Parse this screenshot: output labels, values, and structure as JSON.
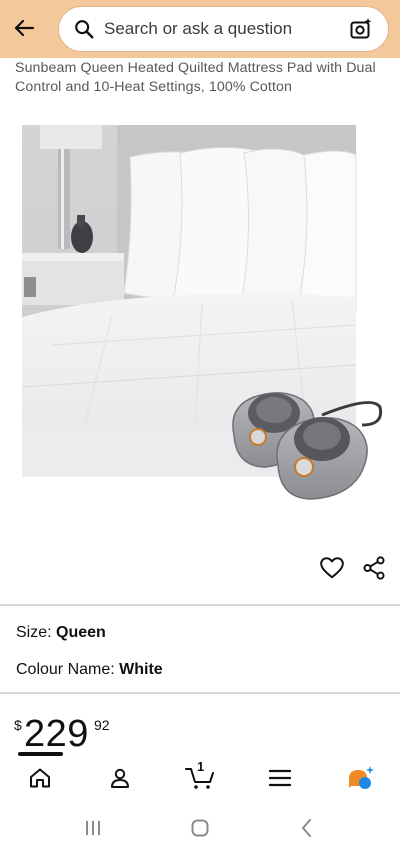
{
  "header": {
    "search_placeholder": "Search or ask a question",
    "background_color": "#f3c89a",
    "icons": [
      "back-arrow-icon",
      "search-icon",
      "camera-search-icon"
    ]
  },
  "product": {
    "title": "Sunbeam Queen Heated Quilted Mattress Pad with Dual Control and 10-Heat Settings, 100% Cotton",
    "specs": [
      {
        "label": "Size:",
        "value": "Queen"
      },
      {
        "label": "Colour Name:",
        "value": "White"
      }
    ],
    "price": {
      "currency": "$",
      "whole": "229",
      "fraction": "92"
    },
    "action_icons": [
      "heart-icon",
      "share-icon"
    ]
  },
  "bottom_nav": {
    "items": [
      "home-icon",
      "account-icon",
      "cart-icon",
      "menu-icon",
      "rufus-icon"
    ],
    "cart_count": "1"
  },
  "system_nav": [
    "recents-icon",
    "home-circle-icon",
    "back-chevron-icon"
  ]
}
